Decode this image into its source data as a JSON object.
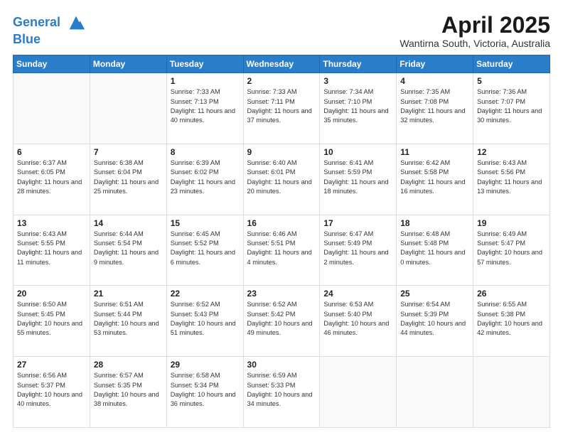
{
  "header": {
    "logo_line1": "General",
    "logo_line2": "Blue",
    "month": "April 2025",
    "location": "Wantirna South, Victoria, Australia"
  },
  "weekdays": [
    "Sunday",
    "Monday",
    "Tuesday",
    "Wednesday",
    "Thursday",
    "Friday",
    "Saturday"
  ],
  "weeks": [
    [
      {
        "day": "",
        "info": ""
      },
      {
        "day": "",
        "info": ""
      },
      {
        "day": "1",
        "info": "Sunrise: 7:33 AM\nSunset: 7:13 PM\nDaylight: 11 hours and 40 minutes."
      },
      {
        "day": "2",
        "info": "Sunrise: 7:33 AM\nSunset: 7:11 PM\nDaylight: 11 hours and 37 minutes."
      },
      {
        "day": "3",
        "info": "Sunrise: 7:34 AM\nSunset: 7:10 PM\nDaylight: 11 hours and 35 minutes."
      },
      {
        "day": "4",
        "info": "Sunrise: 7:35 AM\nSunset: 7:08 PM\nDaylight: 11 hours and 32 minutes."
      },
      {
        "day": "5",
        "info": "Sunrise: 7:36 AM\nSunset: 7:07 PM\nDaylight: 11 hours and 30 minutes."
      }
    ],
    [
      {
        "day": "6",
        "info": "Sunrise: 6:37 AM\nSunset: 6:05 PM\nDaylight: 11 hours and 28 minutes."
      },
      {
        "day": "7",
        "info": "Sunrise: 6:38 AM\nSunset: 6:04 PM\nDaylight: 11 hours and 25 minutes."
      },
      {
        "day": "8",
        "info": "Sunrise: 6:39 AM\nSunset: 6:02 PM\nDaylight: 11 hours and 23 minutes."
      },
      {
        "day": "9",
        "info": "Sunrise: 6:40 AM\nSunset: 6:01 PM\nDaylight: 11 hours and 20 minutes."
      },
      {
        "day": "10",
        "info": "Sunrise: 6:41 AM\nSunset: 5:59 PM\nDaylight: 11 hours and 18 minutes."
      },
      {
        "day": "11",
        "info": "Sunrise: 6:42 AM\nSunset: 5:58 PM\nDaylight: 11 hours and 16 minutes."
      },
      {
        "day": "12",
        "info": "Sunrise: 6:43 AM\nSunset: 5:56 PM\nDaylight: 11 hours and 13 minutes."
      }
    ],
    [
      {
        "day": "13",
        "info": "Sunrise: 6:43 AM\nSunset: 5:55 PM\nDaylight: 11 hours and 11 minutes."
      },
      {
        "day": "14",
        "info": "Sunrise: 6:44 AM\nSunset: 5:54 PM\nDaylight: 11 hours and 9 minutes."
      },
      {
        "day": "15",
        "info": "Sunrise: 6:45 AM\nSunset: 5:52 PM\nDaylight: 11 hours and 6 minutes."
      },
      {
        "day": "16",
        "info": "Sunrise: 6:46 AM\nSunset: 5:51 PM\nDaylight: 11 hours and 4 minutes."
      },
      {
        "day": "17",
        "info": "Sunrise: 6:47 AM\nSunset: 5:49 PM\nDaylight: 11 hours and 2 minutes."
      },
      {
        "day": "18",
        "info": "Sunrise: 6:48 AM\nSunset: 5:48 PM\nDaylight: 11 hours and 0 minutes."
      },
      {
        "day": "19",
        "info": "Sunrise: 6:49 AM\nSunset: 5:47 PM\nDaylight: 10 hours and 57 minutes."
      }
    ],
    [
      {
        "day": "20",
        "info": "Sunrise: 6:50 AM\nSunset: 5:45 PM\nDaylight: 10 hours and 55 minutes."
      },
      {
        "day": "21",
        "info": "Sunrise: 6:51 AM\nSunset: 5:44 PM\nDaylight: 10 hours and 53 minutes."
      },
      {
        "day": "22",
        "info": "Sunrise: 6:52 AM\nSunset: 5:43 PM\nDaylight: 10 hours and 51 minutes."
      },
      {
        "day": "23",
        "info": "Sunrise: 6:52 AM\nSunset: 5:42 PM\nDaylight: 10 hours and 49 minutes."
      },
      {
        "day": "24",
        "info": "Sunrise: 6:53 AM\nSunset: 5:40 PM\nDaylight: 10 hours and 46 minutes."
      },
      {
        "day": "25",
        "info": "Sunrise: 6:54 AM\nSunset: 5:39 PM\nDaylight: 10 hours and 44 minutes."
      },
      {
        "day": "26",
        "info": "Sunrise: 6:55 AM\nSunset: 5:38 PM\nDaylight: 10 hours and 42 minutes."
      }
    ],
    [
      {
        "day": "27",
        "info": "Sunrise: 6:56 AM\nSunset: 5:37 PM\nDaylight: 10 hours and 40 minutes."
      },
      {
        "day": "28",
        "info": "Sunrise: 6:57 AM\nSunset: 5:35 PM\nDaylight: 10 hours and 38 minutes."
      },
      {
        "day": "29",
        "info": "Sunrise: 6:58 AM\nSunset: 5:34 PM\nDaylight: 10 hours and 36 minutes."
      },
      {
        "day": "30",
        "info": "Sunrise: 6:59 AM\nSunset: 5:33 PM\nDaylight: 10 hours and 34 minutes."
      },
      {
        "day": "",
        "info": ""
      },
      {
        "day": "",
        "info": ""
      },
      {
        "day": "",
        "info": ""
      }
    ]
  ]
}
